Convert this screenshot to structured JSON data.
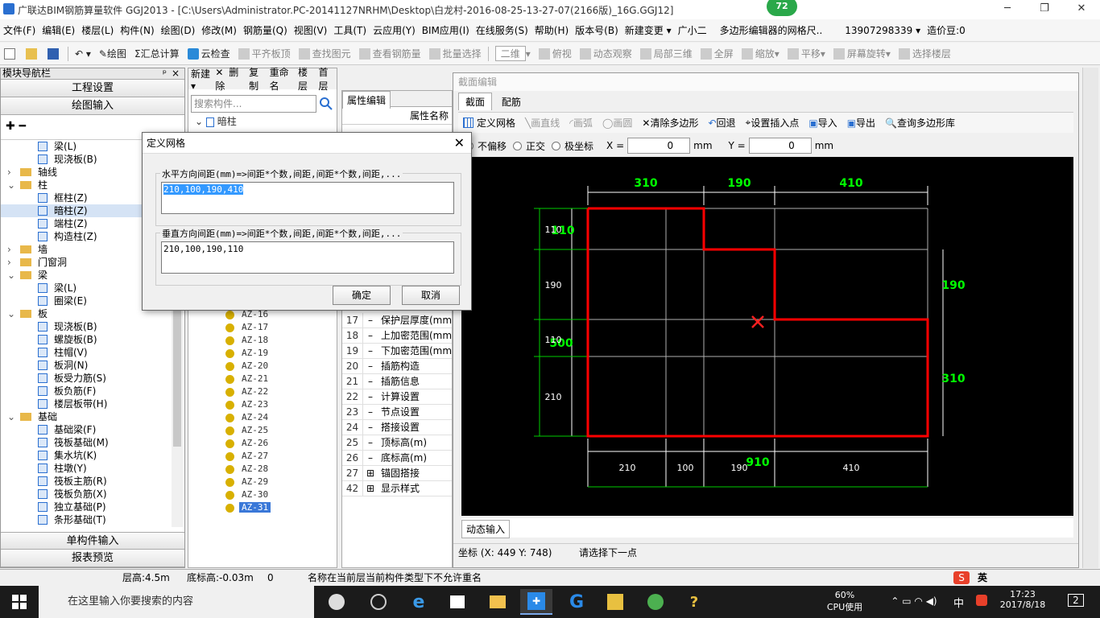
{
  "title_bar": {
    "text": "广联达BIM钢筋算量软件 GGJ2013 - [C:\\Users\\Administrator.PC-20141127NRHM\\Desktop\\白龙村-2016-08-25-13-27-07(2166版)_16G.GGJ12]",
    "badge": "72"
  },
  "menu": [
    "文件(F)",
    "编辑(E)",
    "楼层(L)",
    "构件(N)",
    "绘图(D)",
    "修改(M)",
    "钢筋量(Q)",
    "视图(V)",
    "工具(T)",
    "云应用(Y)",
    "BIM应用(I)",
    "在线服务(S)",
    "帮助(H)",
    "版本号(B)",
    "新建变更 ▾",
    "广小二",
    "多边形编辑器的网格尺..",
    "13907298339 ▾",
    "造价豆:0"
  ],
  "toolbar": [
    "绘图",
    "汇总计算",
    "云检查",
    "平齐板顶",
    "查找图元",
    "查看钢筋量",
    "批量选择",
    "二维",
    "俯视",
    "动态观察",
    "局部三维",
    "全屏",
    "缩放",
    "平移",
    "屏幕旋转",
    "选择楼层"
  ],
  "nav": {
    "header": "模块导航栏",
    "project_btn": "工程设置",
    "draw_btn": "绘图输入",
    "tree": [
      {
        "t": "梁(L)",
        "lvl": 2
      },
      {
        "t": "现浇板(B)",
        "lvl": 2
      },
      {
        "t": "轴线",
        "lvl": 1,
        "f": "+"
      },
      {
        "t": "柱",
        "lvl": 1,
        "f": "-"
      },
      {
        "t": "框柱(Z)",
        "lvl": 2
      },
      {
        "t": "暗柱(Z)",
        "lvl": 2,
        "sel": true
      },
      {
        "t": "端柱(Z)",
        "lvl": 2
      },
      {
        "t": "构造柱(Z)",
        "lvl": 2
      },
      {
        "t": "墙",
        "lvl": 1,
        "f": "+"
      },
      {
        "t": "门窗洞",
        "lvl": 1,
        "f": "+"
      },
      {
        "t": "梁",
        "lvl": 1,
        "f": "-"
      },
      {
        "t": "梁(L)",
        "lvl": 2
      },
      {
        "t": "圈梁(E)",
        "lvl": 2
      },
      {
        "t": "板",
        "lvl": 1,
        "f": "-"
      },
      {
        "t": "现浇板(B)",
        "lvl": 2
      },
      {
        "t": "螺旋板(B)",
        "lvl": 2
      },
      {
        "t": "柱帽(V)",
        "lvl": 2
      },
      {
        "t": "板洞(N)",
        "lvl": 2
      },
      {
        "t": "板受力筋(S)",
        "lvl": 2
      },
      {
        "t": "板负筋(F)",
        "lvl": 2
      },
      {
        "t": "楼层板带(H)",
        "lvl": 2
      },
      {
        "t": "基础",
        "lvl": 1,
        "f": "-"
      },
      {
        "t": "基础梁(F)",
        "lvl": 2
      },
      {
        "t": "筏板基础(M)",
        "lvl": 2
      },
      {
        "t": "集水坑(K)",
        "lvl": 2
      },
      {
        "t": "柱墩(Y)",
        "lvl": 2
      },
      {
        "t": "筏板主筋(R)",
        "lvl": 2
      },
      {
        "t": "筏板负筋(X)",
        "lvl": 2
      },
      {
        "t": "独立基础(P)",
        "lvl": 2
      },
      {
        "t": "条形基础(T)",
        "lvl": 2
      }
    ],
    "single_btn": "单构件输入",
    "report_btn": "报表预览"
  },
  "comp": {
    "toolbar": [
      "新建▾",
      "删除",
      "复制",
      "重命名",
      "楼层",
      "首层"
    ],
    "search_ph": "搜索构件...",
    "root": "暗柱",
    "items": [
      "AZ-16",
      "AZ-17",
      "AZ-18",
      "AZ-19",
      "AZ-20",
      "AZ-21",
      "AZ-22",
      "AZ-23",
      "AZ-24",
      "AZ-25",
      "AZ-26",
      "AZ-27",
      "AZ-28",
      "AZ-29",
      "AZ-30",
      "AZ-31"
    ]
  },
  "prop": {
    "tab": "属性编辑",
    "col": "属性名称",
    "rows": [
      {
        "n": "17",
        "t": "保护层厚度(mm)"
      },
      {
        "n": "18",
        "t": "上加密范围(mm)"
      },
      {
        "n": "19",
        "t": "下加密范围(mm)"
      },
      {
        "n": "20",
        "t": "插筋构造"
      },
      {
        "n": "21",
        "t": "插筋信息"
      },
      {
        "n": "22",
        "t": "计算设置"
      },
      {
        "n": "23",
        "t": "节点设置"
      },
      {
        "n": "24",
        "t": "搭接设置"
      },
      {
        "n": "25",
        "t": "顶标高(m)"
      },
      {
        "n": "26",
        "t": "底标高(m)"
      },
      {
        "n": "27",
        "t": "锚固搭接",
        "f": "+"
      },
      {
        "n": "42",
        "t": "显示样式",
        "f": "+"
      }
    ]
  },
  "section": {
    "caption": "截面编辑",
    "tabs": [
      "截面",
      "配筋"
    ],
    "tools": [
      "定义网格",
      "画直线",
      "画弧",
      "画圆",
      "清除多边形",
      "回退",
      "设置插入点",
      "导入",
      "导出",
      "查询多边形库"
    ],
    "opts": {
      "r1": "不偏移",
      "r2": "正交",
      "r3": "极坐标",
      "x_label": "X =",
      "x_val": "0",
      "unit1": "mm",
      "y_label": "Y =",
      "y_val": "0",
      "unit2": "mm"
    },
    "dims_top": [
      "310",
      "190",
      "410"
    ],
    "dims_bottom": [
      "210",
      "100",
      "190",
      "410"
    ],
    "dim_bottom_total": "910",
    "dims_left": [
      "110",
      "190",
      "110",
      "210"
    ],
    "dims_left_green": [
      "110",
      "500"
    ],
    "dims_right": [
      "190",
      "310"
    ],
    "dynamic": "动态输入",
    "coord_label": "坐标 (X: 449 Y: 748)",
    "prompt": "请选择下一点"
  },
  "dialog": {
    "title": "定义网格",
    "h_label": "水平方向间距(mm)=>间距*个数,间距,间距*个数,间距,...",
    "h_value": "210,100,190,410",
    "v_label": "垂直方向间距(mm)=>间距*个数,间距,间距*个数,间距,...",
    "v_value": "210,100,190,110",
    "ok": "确定",
    "cancel": "取消"
  },
  "status": {
    "s1": "层高:4.5m",
    "s2": "底标高:-0.03m",
    "s3": "0",
    "s4": "名称在当前层当前构件类型下不允许重名",
    "ime": "英"
  },
  "taskbar": {
    "search_ph": "在这里输入你要搜索的内容",
    "cpu_pct": "60%",
    "cpu_label": "CPU使用",
    "ime": "中",
    "time": "17:23",
    "date": "2017/8/18",
    "notif": "2"
  },
  "colors": {
    "accent": "#3a78d8",
    "poly": "#ff0000",
    "dim_green": "#00ff00"
  }
}
